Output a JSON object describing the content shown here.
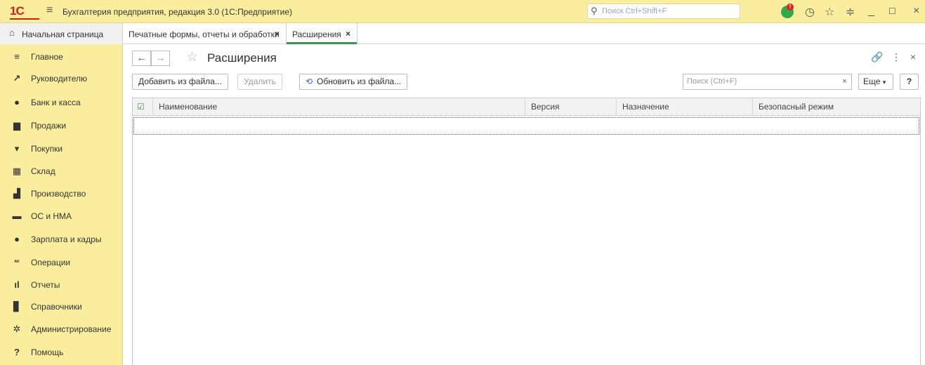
{
  "titlebar": {
    "logo": "1С",
    "app_title": "Бухгалтерия предприятия, редакция 3.0  (1С:Предприятие)",
    "search_placeholder": "Поиск Ctrl+Shift+F",
    "notification_badge": "!"
  },
  "tabs": {
    "home": "Начальная страница",
    "items": [
      {
        "label": "Печатные формы, отчеты и обработки",
        "close": "×"
      },
      {
        "label": "Расширения",
        "close": "×"
      }
    ]
  },
  "sidebar": {
    "items": [
      {
        "label": "Главное",
        "icon": "≡"
      },
      {
        "label": "Руководителю",
        "icon": "↗"
      },
      {
        "label": "Банк и касса",
        "icon": "●"
      },
      {
        "label": "Продажи",
        "icon": "▆"
      },
      {
        "label": "Покупки",
        "icon": "▾"
      },
      {
        "label": "Склад",
        "icon": "▦"
      },
      {
        "label": "Производство",
        "icon": "▟"
      },
      {
        "label": "ОС и НМА",
        "icon": "▬"
      },
      {
        "label": "Зарплата и кадры",
        "icon": "●"
      },
      {
        "label": "Операции",
        "icon": "ᴬᴷ"
      },
      {
        "label": "Отчеты",
        "icon": "ıl"
      },
      {
        "label": "Справочники",
        "icon": "▊"
      },
      {
        "label": "Администрирование",
        "icon": "✲"
      },
      {
        "label": "Помощь",
        "icon": "?"
      }
    ]
  },
  "form": {
    "title": "Расширения",
    "toolbar": {
      "add_from_file": "Добавить из файла...",
      "delete": "Удалить",
      "update_from_file": "Обновить из файла...",
      "search_placeholder": "Поиск (Ctrl+F)",
      "clear": "×",
      "more": "Еще",
      "help": "?"
    },
    "table": {
      "columns": [
        "Наименование",
        "Версия",
        "Назначение",
        "Безопасный режим"
      ],
      "rows": []
    }
  }
}
